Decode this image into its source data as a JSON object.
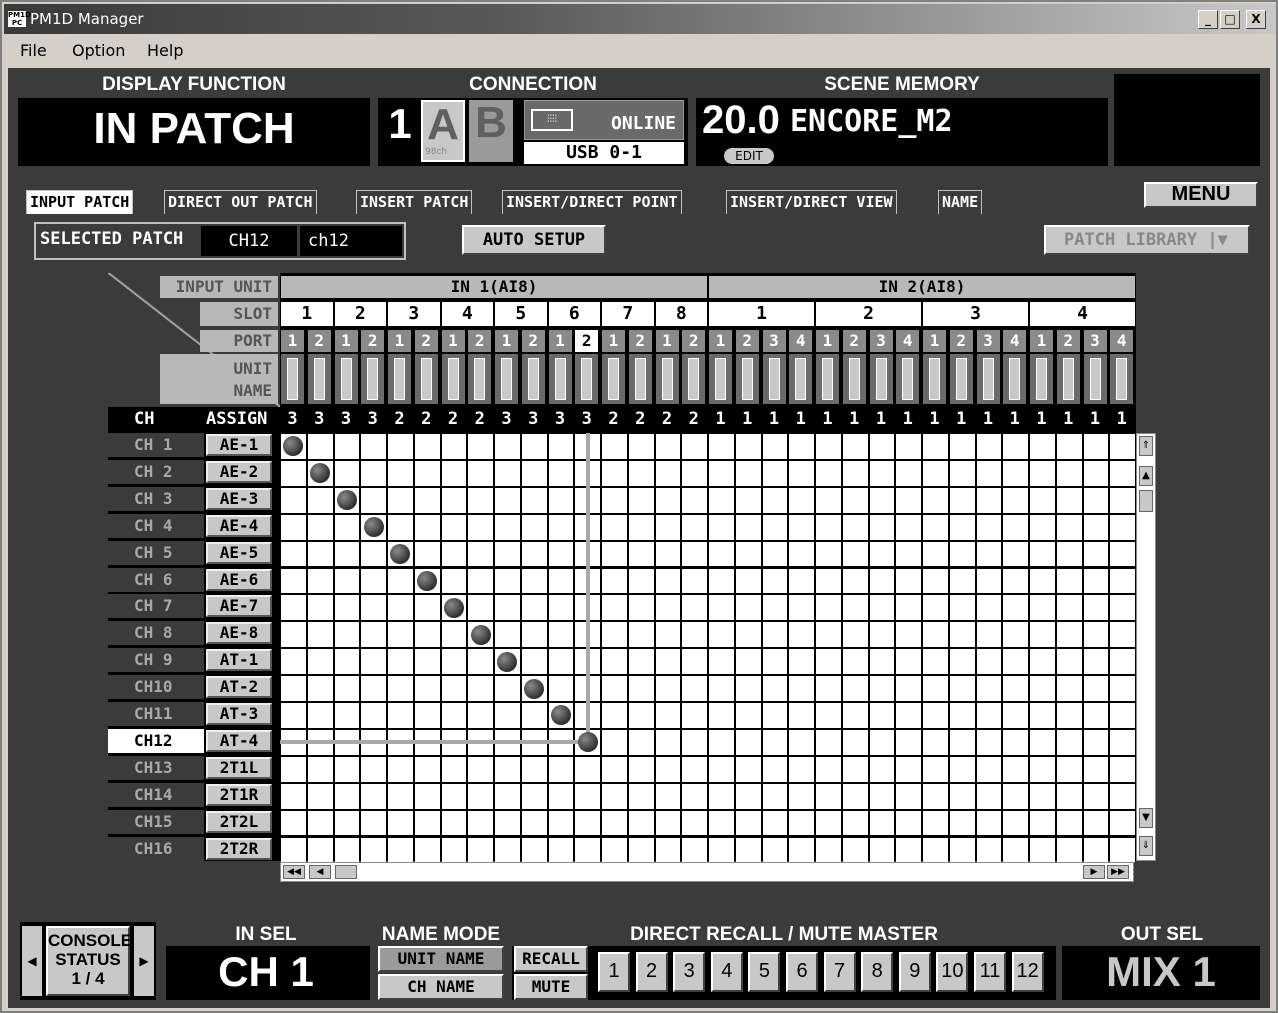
{
  "window": {
    "title": "PM1D Manager",
    "icon_text": "PM1D PC",
    "min": "_",
    "max": "□",
    "close": "X"
  },
  "menu": {
    "file": "File",
    "option": "Option",
    "help": "Help"
  },
  "display_function": {
    "label": "DISPLAY FUNCTION",
    "value": "IN PATCH"
  },
  "connection": {
    "label": "CONNECTION",
    "number": "1",
    "a": "A",
    "b": "B",
    "b_sub": "98ch",
    "status": "ONLINE",
    "port": "USB 0-1"
  },
  "scene_memory": {
    "label": "SCENE MEMORY",
    "number": "20.0",
    "name": "ENCORE_M2",
    "edit": "EDIT"
  },
  "tabs": [
    "INPUT PATCH",
    "DIRECT OUT PATCH",
    "INSERT PATCH",
    "INSERT/DIRECT POINT",
    "INSERT/DIRECT VIEW",
    "NAME"
  ],
  "menu_button": "MENU",
  "selected_patch": {
    "label": "SELECTED PATCH",
    "channel": "CH12",
    "name": "ch12"
  },
  "auto_setup": "AUTO SETUP",
  "patch_library": "PATCH LIBRARY",
  "patch_library_arrow": "|▼",
  "grid": {
    "input_unit_label": "INPUT UNIT",
    "slot_label": "SLOT",
    "port_label": "PORT",
    "unit_name_label": "UNIT NAME",
    "ch_label": "CH",
    "assign_label": "ASSIGN",
    "units": [
      {
        "name": "IN 1(AI8)",
        "slots": [
          "1",
          "2",
          "3",
          "4",
          "5",
          "6",
          "7",
          "8"
        ]
      },
      {
        "name": "IN 2(AI8)",
        "slots": [
          "1",
          "2",
          "3",
          "4"
        ]
      }
    ],
    "ports": [
      "1",
      "2",
      "1",
      "2",
      "1",
      "2",
      "1",
      "2",
      "1",
      "2",
      "1",
      "2",
      "1",
      "2",
      "1",
      "2",
      "1",
      "2",
      "3",
      "4",
      "1",
      "2",
      "3",
      "4",
      "1",
      "2",
      "3",
      "4",
      "1",
      "2",
      "3",
      "4"
    ],
    "assign": [
      "3",
      "3",
      "3",
      "3",
      "2",
      "2",
      "2",
      "2",
      "3",
      "3",
      "3",
      "3",
      "2",
      "2",
      "2",
      "2",
      "1",
      "1",
      "1",
      "1",
      "1",
      "1",
      "1",
      "1",
      "1",
      "1",
      "1",
      "1",
      "1",
      "1",
      "1",
      "1"
    ],
    "channels": [
      {
        "ch": "CH 1",
        "btn": "AE-1",
        "patch": 0
      },
      {
        "ch": "CH 2",
        "btn": "AE-2",
        "patch": 1
      },
      {
        "ch": "CH 3",
        "btn": "AE-3",
        "patch": 2
      },
      {
        "ch": "CH 4",
        "btn": "AE-4",
        "patch": 3
      },
      {
        "ch": "CH 5",
        "btn": "AE-5",
        "patch": 4
      },
      {
        "ch": "CH 6",
        "btn": "AE-6",
        "patch": 5
      },
      {
        "ch": "CH 7",
        "btn": "AE-7",
        "patch": 6
      },
      {
        "ch": "CH 8",
        "btn": "AE-8",
        "patch": 7
      },
      {
        "ch": "CH 9",
        "btn": "AT-1",
        "patch": 8
      },
      {
        "ch": "CH10",
        "btn": "AT-2",
        "patch": 9
      },
      {
        "ch": "CH11",
        "btn": "AT-3",
        "patch": 10
      },
      {
        "ch": "CH12",
        "btn": "AT-4",
        "patch": 11
      },
      {
        "ch": "CH13",
        "btn": "2T1L",
        "patch": -1
      },
      {
        "ch": "CH14",
        "btn": "2T1R",
        "patch": -1
      },
      {
        "ch": "CH15",
        "btn": "2T2L",
        "patch": -1
      },
      {
        "ch": "CH16",
        "btn": "2T2R",
        "patch": -1
      }
    ],
    "selected_row": 11,
    "selected_col": 11
  },
  "bottom": {
    "console_status": "CONSOLE STATUS",
    "console_page": "1 / 4",
    "in_sel_label": "IN SEL",
    "in_sel_value": "CH 1",
    "name_mode_label": "NAME MODE",
    "unit_name": "UNIT NAME",
    "ch_name": "CH NAME",
    "direct_recall_label": "DIRECT RECALL / MUTE MASTER",
    "recall": "RECALL",
    "mute": "MUTE",
    "recall_buttons": [
      "1",
      "2",
      "3",
      "4",
      "5",
      "6",
      "7",
      "8",
      "9",
      "10",
      "11",
      "12"
    ],
    "out_sel_label": "OUT SEL",
    "out_sel_value": "MIX 1"
  }
}
